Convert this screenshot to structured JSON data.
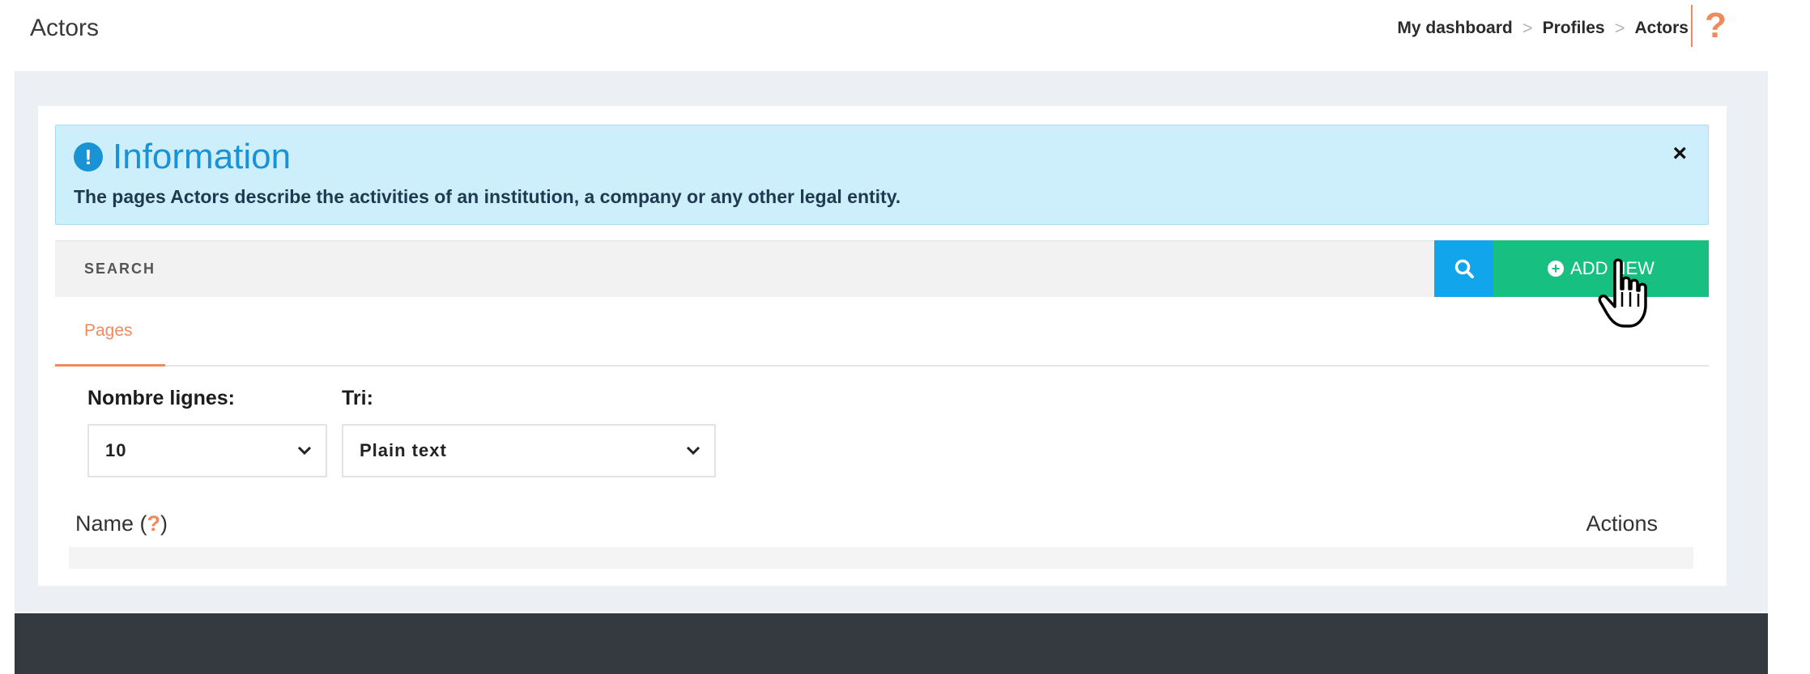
{
  "header": {
    "page_title": "Actors",
    "breadcrumb": [
      "My dashboard",
      "Profiles",
      "Actors"
    ],
    "help_icon": "?"
  },
  "alert": {
    "icon": "!",
    "title": "Information",
    "text": "The pages Actors describe the activities of an institution, a company or any other legal entity.",
    "close": "×"
  },
  "search": {
    "label": "SEARCH",
    "add_new_label": "ADD NEW"
  },
  "tabs": [
    {
      "label": "Pages",
      "active": true
    }
  ],
  "filters": {
    "rows_label": "Nombre lignes:",
    "rows_value": "10",
    "sort_label": "Tri:",
    "sort_value": "Plain text"
  },
  "table": {
    "col_name": "Name (",
    "col_name_help": "?",
    "col_name_close": ")",
    "col_actions": "Actions"
  },
  "colors": {
    "accent": "#f08a5d",
    "info_blue": "#1a92d6",
    "search_blue": "#11a6ec",
    "add_green": "#17c081",
    "footer": "#343a40"
  }
}
